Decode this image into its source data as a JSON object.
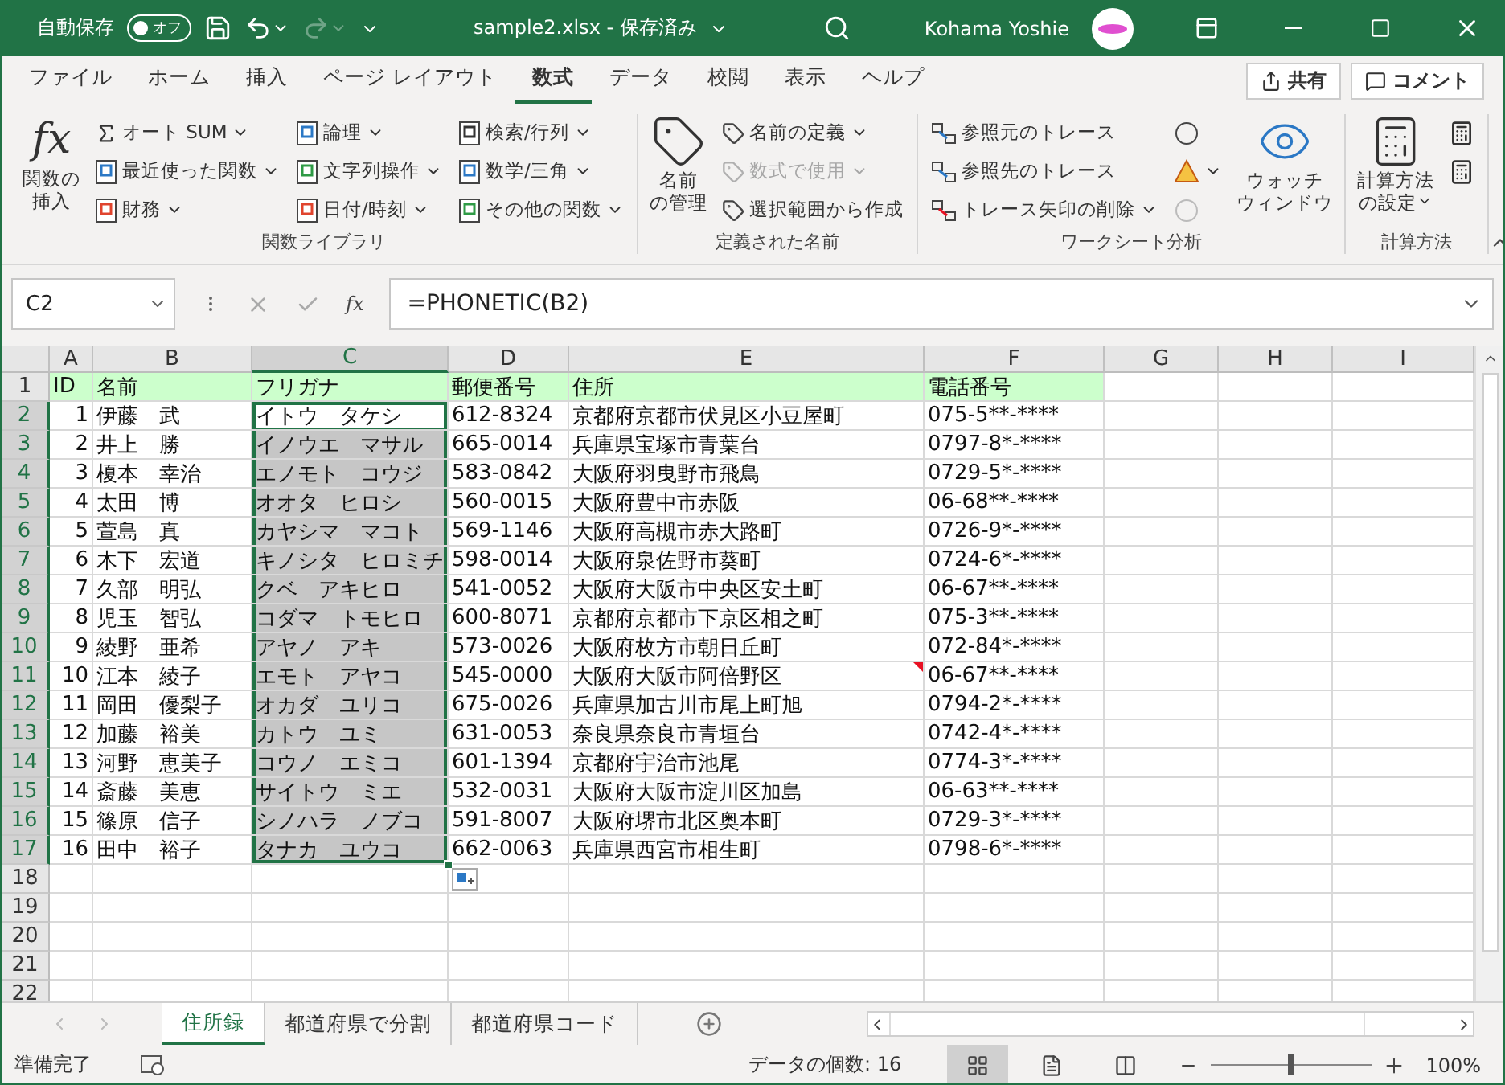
{
  "title_bar": {
    "autosave_label": "自動保存",
    "autosave_toggle": {
      "label": "オフ",
      "on": false
    },
    "redo_disabled": true,
    "file_title": "sample2.xlsx  -  保存済み",
    "user_name": "Kohama Yoshie"
  },
  "ribbon_tabs": [
    {
      "label": "ファイル",
      "selected": false
    },
    {
      "label": "ホーム",
      "selected": false
    },
    {
      "label": "挿入",
      "selected": false
    },
    {
      "label": "ページ レイアウト",
      "selected": false
    },
    {
      "label": "数式",
      "selected": true
    },
    {
      "label": "データ",
      "selected": false
    },
    {
      "label": "校閲",
      "selected": false
    },
    {
      "label": "表示",
      "selected": false
    },
    {
      "label": "ヘルプ",
      "selected": false
    }
  ],
  "share_button": "共有",
  "comment_button": "コメント",
  "ribbon_groups": [
    {
      "label": "関数ライブラリ",
      "controls": [
        {
          "kind": "large",
          "icon_text": "fx",
          "lines": [
            "関数の",
            "挿入"
          ],
          "dropdown": false
        },
        {
          "kind": "column",
          "items": [
            {
              "label": "オート SUM",
              "dropdown": true,
              "disabled": false
            },
            {
              "label": "最近使った関数",
              "dropdown": true,
              "disabled": false
            },
            {
              "label": "財務",
              "dropdown": true,
              "disabled": false
            }
          ]
        },
        {
          "kind": "column",
          "items": [
            {
              "label": "論理",
              "dropdown": true,
              "disabled": false
            },
            {
              "label": "文字列操作",
              "dropdown": true,
              "disabled": false
            },
            {
              "label": "日付/時刻",
              "dropdown": true,
              "disabled": false
            }
          ]
        },
        {
          "kind": "column",
          "items": [
            {
              "label": "検索/行列",
              "dropdown": true,
              "disabled": false
            },
            {
              "label": "数学/三角",
              "dropdown": true,
              "disabled": false
            },
            {
              "label": "その他の関数",
              "dropdown": true,
              "disabled": false
            }
          ]
        }
      ]
    },
    {
      "label": "定義された名前",
      "controls": [
        {
          "kind": "large",
          "lines": [
            "名前",
            "の管理"
          ],
          "dropdown": false
        },
        {
          "kind": "column",
          "items": [
            {
              "label": "名前の定義",
              "dropdown": true,
              "disabled": false
            },
            {
              "label": "数式で使用",
              "dropdown": true,
              "disabled": true
            },
            {
              "label": "選択範囲から作成",
              "dropdown": false,
              "disabled": false
            }
          ]
        }
      ]
    },
    {
      "label": "ワークシート分析",
      "controls": [
        {
          "kind": "column",
          "items": [
            {
              "label": "参照元のトレース",
              "dropdown": false,
              "disabled": false
            },
            {
              "label": "参照先のトレース",
              "dropdown": false,
              "disabled": false
            },
            {
              "label": "トレース矢印の削除",
              "dropdown": true,
              "disabled": false
            }
          ]
        },
        {
          "kind": "column",
          "items": [
            {
              "dropdown": false,
              "disabled": false
            },
            {
              "dropdown": true,
              "disabled": false
            },
            {
              "dropdown": false,
              "disabled": true
            }
          ]
        },
        {
          "kind": "large",
          "lines": [
            "ウォッチ",
            "ウィンドウ"
          ],
          "dropdown": false
        }
      ]
    },
    {
      "label": "計算方法",
      "controls": [
        {
          "kind": "large",
          "lines": [
            "計算方法",
            "の設定"
          ],
          "dropdown": true
        },
        {
          "kind": "column",
          "items": [
            {
              "dropdown": false,
              "disabled": false
            },
            {
              "dropdown": false,
              "disabled": false
            }
          ]
        }
      ]
    }
  ],
  "formula_bar": {
    "name_box": "C2",
    "function_label": "fx",
    "formula": "=PHONETIC(B2)"
  },
  "columns": [
    {
      "label": "A",
      "selected": false
    },
    {
      "label": "B",
      "selected": false
    },
    {
      "label": "C",
      "selected": true
    },
    {
      "label": "D",
      "selected": false
    },
    {
      "label": "E",
      "selected": false
    },
    {
      "label": "F",
      "selected": false
    },
    {
      "label": "G",
      "selected": false
    },
    {
      "label": "H",
      "selected": false
    },
    {
      "label": "I",
      "selected": false
    }
  ],
  "rows": [
    {
      "num": "1",
      "kind": "header",
      "selected": false,
      "active": false,
      "address_comment": false,
      "cells": [
        "ID",
        "名前",
        "フリガナ",
        "郵便番号",
        "住所",
        "電話番号"
      ]
    },
    {
      "num": "2",
      "kind": "data",
      "selected": true,
      "active": true,
      "address_comment": false,
      "cells": [
        "1",
        "伊藤　武",
        "イトウ　タケシ",
        "612-8324",
        "京都府京都市伏見区小豆屋町",
        "075-5**-****"
      ]
    },
    {
      "num": "3",
      "kind": "data",
      "selected": true,
      "active": false,
      "address_comment": false,
      "cells": [
        "2",
        "井上　勝",
        "イノウエ　マサル",
        "665-0014",
        "兵庫県宝塚市青葉台",
        "0797-8*-****"
      ]
    },
    {
      "num": "4",
      "kind": "data",
      "selected": true,
      "active": false,
      "address_comment": false,
      "cells": [
        "3",
        "榎本　幸治",
        "エノモト　コウジ",
        "583-0842",
        "大阪府羽曳野市飛鳥",
        "0729-5*-****"
      ]
    },
    {
      "num": "5",
      "kind": "data",
      "selected": true,
      "active": false,
      "address_comment": false,
      "cells": [
        "4",
        "太田　博",
        "オオタ　ヒロシ",
        "560-0015",
        "大阪府豊中市赤阪",
        "06-68**-****"
      ]
    },
    {
      "num": "6",
      "kind": "data",
      "selected": true,
      "active": false,
      "address_comment": false,
      "cells": [
        "5",
        "萱島　真",
        "カヤシマ　マコト",
        "569-1146",
        "大阪府高槻市赤大路町",
        "0726-9*-****"
      ]
    },
    {
      "num": "7",
      "kind": "data",
      "selected": true,
      "active": false,
      "address_comment": false,
      "cells": [
        "6",
        "木下　宏道",
        "キノシタ　ヒロミチ",
        "598-0014",
        "大阪府泉佐野市葵町",
        "0724-6*-****"
      ]
    },
    {
      "num": "8",
      "kind": "data",
      "selected": true,
      "active": false,
      "address_comment": false,
      "cells": [
        "7",
        "久部　明弘",
        "クベ　アキヒロ",
        "541-0052",
        "大阪府大阪市中央区安土町",
        "06-67**-****"
      ]
    },
    {
      "num": "9",
      "kind": "data",
      "selected": true,
      "active": false,
      "address_comment": false,
      "cells": [
        "8",
        "児玉　智弘",
        "コダマ　トモヒロ",
        "600-8071",
        "京都府京都市下京区相之町",
        "075-3**-****"
      ]
    },
    {
      "num": "10",
      "kind": "data",
      "selected": true,
      "active": false,
      "address_comment": false,
      "cells": [
        "9",
        "綾野　亜希",
        "アヤノ　アキ",
        "573-0026",
        "大阪府枚方市朝日丘町",
        "072-84*-****"
      ]
    },
    {
      "num": "11",
      "kind": "data",
      "selected": true,
      "active": false,
      "address_comment": true,
      "cells": [
        "10",
        "江本　綾子",
        "エモト　アヤコ",
        "545-0000",
        "大阪府大阪市阿倍野区",
        "06-67**-****"
      ]
    },
    {
      "num": "12",
      "kind": "data",
      "selected": true,
      "active": false,
      "address_comment": false,
      "cells": [
        "11",
        "岡田　優梨子",
        "オカダ　ユリコ",
        "675-0026",
        "兵庫県加古川市尾上町旭",
        "0794-2*-****"
      ]
    },
    {
      "num": "13",
      "kind": "data",
      "selected": true,
      "active": false,
      "address_comment": false,
      "cells": [
        "12",
        "加藤　裕美",
        "カトウ　ユミ",
        "631-0053",
        "奈良県奈良市青垣台",
        "0742-4*-****"
      ]
    },
    {
      "num": "14",
      "kind": "data",
      "selected": true,
      "active": false,
      "address_comment": false,
      "cells": [
        "13",
        "河野　恵美子",
        "コウノ　エミコ",
        "601-1394",
        "京都府宇治市池尾",
        "0774-3*-****"
      ]
    },
    {
      "num": "15",
      "kind": "data",
      "selected": true,
      "active": false,
      "address_comment": false,
      "cells": [
        "14",
        "斎藤　美恵",
        "サイトウ　ミエ",
        "532-0031",
        "大阪府大阪市淀川区加島",
        "06-63**-****"
      ]
    },
    {
      "num": "16",
      "kind": "data",
      "selected": true,
      "active": false,
      "address_comment": false,
      "cells": [
        "15",
        "篠原　信子",
        "シノハラ　ノブコ",
        "591-8007",
        "大阪府堺市北区奥本町",
        "0729-3*-****"
      ]
    },
    {
      "num": "17",
      "kind": "data",
      "selected": true,
      "active": false,
      "address_comment": false,
      "cells": [
        "16",
        "田中　裕子",
        "タナカ　ユウコ",
        "662-0063",
        "兵庫県西宮市相生町",
        "0798-6*-****"
      ]
    },
    {
      "num": "18",
      "kind": "empty",
      "selected": false,
      "active": false,
      "address_comment": false
    },
    {
      "num": "19",
      "kind": "empty",
      "selected": false,
      "active": false,
      "address_comment": false
    },
    {
      "num": "20",
      "kind": "empty",
      "selected": false,
      "active": false,
      "address_comment": false
    },
    {
      "num": "21",
      "kind": "empty",
      "selected": false,
      "active": false,
      "address_comment": false
    },
    {
      "num": "22",
      "kind": "empty",
      "selected": false,
      "active": false,
      "address_comment": false
    }
  ],
  "sheet_tabs": [
    {
      "label": "住所録",
      "selected": true
    },
    {
      "label": "都道府県で分割",
      "selected": false
    },
    {
      "label": "都道府県コード",
      "selected": false
    }
  ],
  "status_bar": {
    "status": "準備完了",
    "count": "データの個数: 16",
    "view_modes": [
      {
        "kind": "normal",
        "selected": true
      },
      {
        "kind": "page_layout",
        "selected": false
      },
      {
        "kind": "page_break",
        "selected": false
      }
    ],
    "zoom": {
      "level": 0.5,
      "reading": "100%"
    }
  }
}
